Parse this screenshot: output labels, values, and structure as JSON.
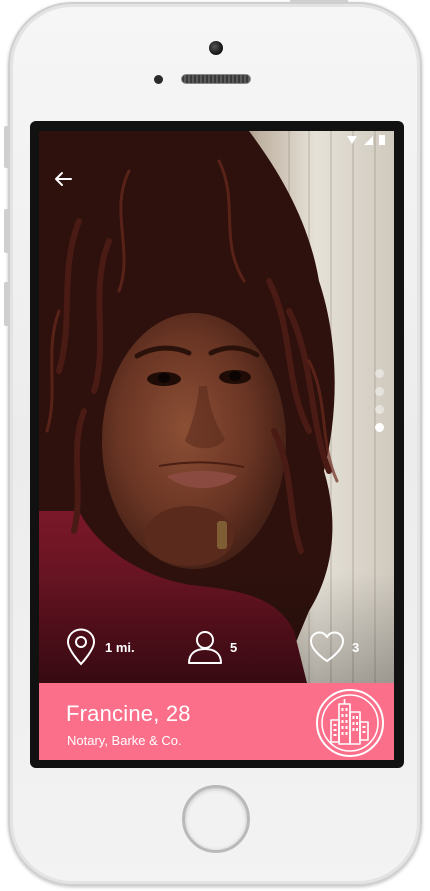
{
  "screen": {
    "back_button": {
      "icon": "arrow-left-icon"
    },
    "photo": {
      "description_icon": "profile-photo"
    },
    "page_indicator": {
      "count": 4,
      "active_index": 3
    },
    "stats": {
      "distance": {
        "icon": "location-pin-icon",
        "value": "1 mi."
      },
      "friends": {
        "icon": "person-icon",
        "value": "5"
      },
      "likes": {
        "icon": "heart-icon",
        "value": "3"
      }
    },
    "profile": {
      "name_age": "Francine, 28",
      "occupation": "Notary, Barke & Co.",
      "badge_icon": "city-buildings-icon"
    }
  },
  "colors": {
    "accent": "#fc6f8a",
    "text_on_accent": "#ffffff",
    "device_frame": "#f0f0f0"
  }
}
